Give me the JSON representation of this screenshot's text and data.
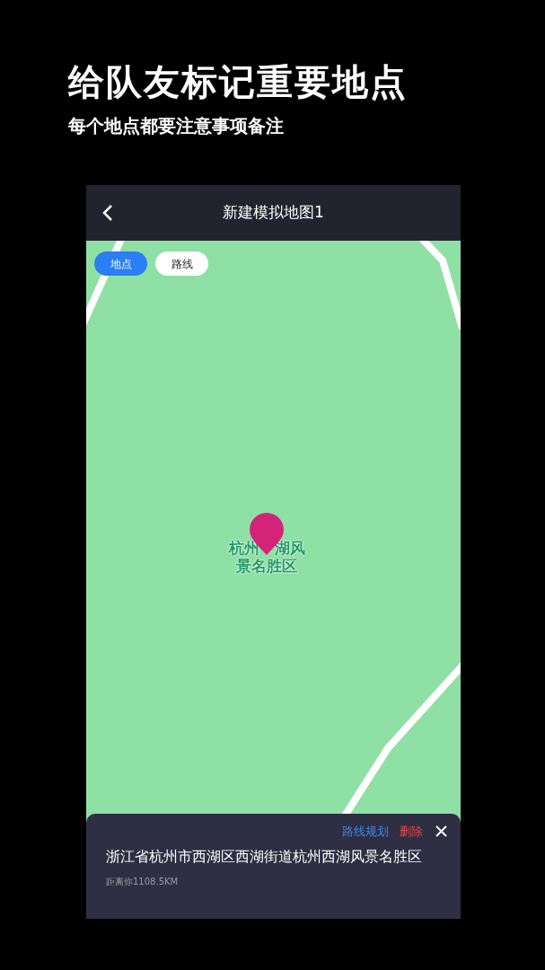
{
  "headline": "给队友标记重要地点",
  "subheadline": "每个地点都要注意事项备注",
  "screen": {
    "title": "新建模拟地图1",
    "tabs": [
      {
        "label": "地点",
        "selected": true
      },
      {
        "label": "路线",
        "selected": false
      }
    ],
    "map_label": [
      "杭州",
      "湖风",
      "景名胜区"
    ],
    "detail": {
      "route_action": "路线规划",
      "delete_action": "删除",
      "address": "浙江省杭州市西湖区西湖街道杭州西湖风景名胜区",
      "distance": "距离你1108.5KM"
    }
  }
}
